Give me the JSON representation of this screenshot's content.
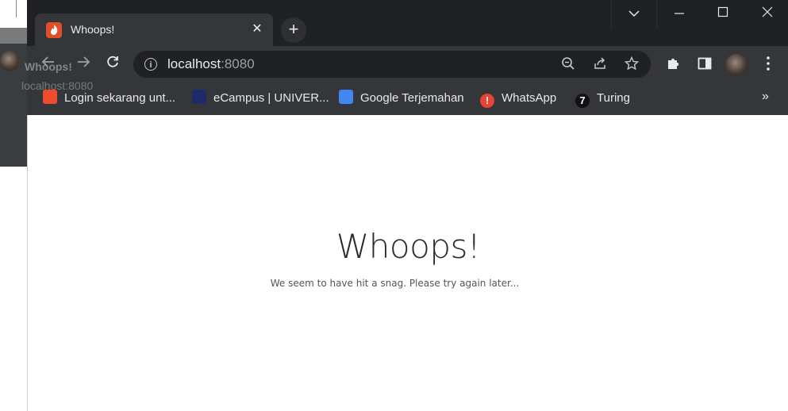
{
  "tab": {
    "title": "Whoops!",
    "close_icon": "close-icon"
  },
  "omnibox": {
    "host": "localhost",
    "port": ":8080"
  },
  "tooltip": {
    "title": "Whoops!",
    "url": "localhost:8080"
  },
  "bookmarks": [
    {
      "label": "Login sekarang unt...",
      "icon_color": "#ee4d2d"
    },
    {
      "label": "eCampus | UNIVER...",
      "icon_color": "#1f2a6b"
    },
    {
      "label": "Google Terjemahan",
      "icon_color": "#4285f4"
    },
    {
      "label": "WhatsApp",
      "icon_color": "#ea4335"
    },
    {
      "label": "Turing",
      "icon_color": "#111111"
    }
  ],
  "page": {
    "heading": "Whoops!",
    "message": "We seem to have hit a snag. Please try again later..."
  },
  "colors": {
    "titlebar": "#202124",
    "toolbar": "#35363a",
    "accent": "#e04e2a"
  }
}
